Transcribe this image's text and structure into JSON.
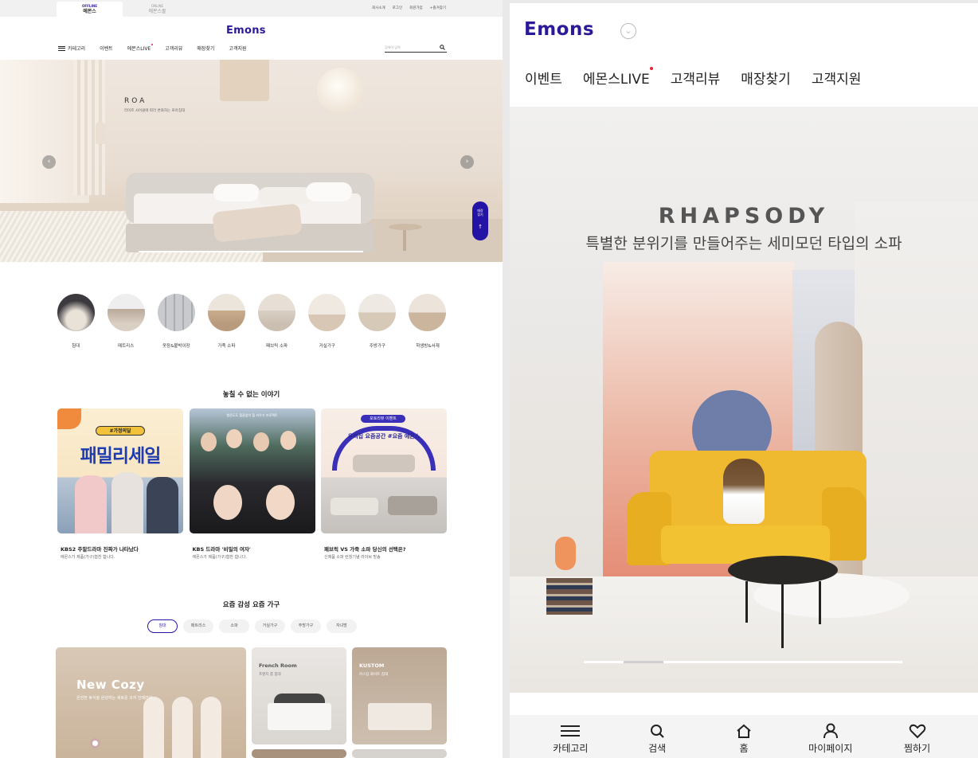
{
  "desktop": {
    "site_tabs": [
      {
        "top": "OFFLINE",
        "label": "에몬스"
      },
      {
        "top": "ONLINE",
        "label": "에몬스몰"
      }
    ],
    "util_links": [
      "회사소개",
      "로그인",
      "회원가입",
      "+즐겨찾기"
    ],
    "logo": "Emons",
    "nav": {
      "category": "카테고리",
      "items": [
        "이벤트",
        "에몬스LIVE",
        "고객리뷰",
        "매장찾기",
        "고객지원"
      ]
    },
    "search": {
      "placeholder": "검색어 입력"
    },
    "hero": {
      "title": "ROA",
      "subtitle": "라이프 사이클에 따라 변화하는 로아침대",
      "store_label_1": "매장",
      "store_label_2": "찾기"
    },
    "categories": [
      "침대",
      "매트리스",
      "옷장&붙박이장",
      "가죽 소파",
      "패브릭 소파",
      "거실가구",
      "주방가구",
      "학생방&서재"
    ],
    "stories_heading": "놓칠 수 없는 이야기",
    "stories": [
      {
        "badge": "#가정의달",
        "banner": "패밀리세일",
        "title": "KBS2 주말드라마 진짜가 나타났다",
        "subtitle": "에몬스가 제품(가구)협찬 합니다."
      },
      {
        "badge": "험준도도 힐끝없이 힐 키우기 프로젝트",
        "banner": "",
        "title": "KBS 드라마 '비밀의 여자'",
        "subtitle": "에몬스가 제품(가구)협찬 합니다."
      },
      {
        "badge": "포토리뷰 이벤트",
        "banner": "우리집 요즘공간 #요즘 에몬스",
        "title": "패브릭 VS 가죽 소파 당신의 선택은?",
        "subtitle": "신제품 소파 런칭기념 라이브 방송"
      }
    ],
    "trend_heading": "요즘 감성 요즘 가구",
    "filters": [
      "침대",
      "매트리스",
      "소파",
      "거실가구",
      "주방가구",
      "자녀방"
    ],
    "products": [
      {
        "title": "New Cozy",
        "subtitle": "온전한 휴식을 완성하는 새로운 코지 인테리어"
      },
      {
        "title": "French Room",
        "subtitle": "프렌치 룸 침대"
      },
      {
        "title": "KUSTOM",
        "subtitle": "커스텀 화이트 침대"
      }
    ]
  },
  "mobile": {
    "logo": "Emons",
    "nav": [
      "이벤트",
      "에몬스LIVE",
      "고객리뷰",
      "매장찾기",
      "고객지원"
    ],
    "hero": {
      "title": "RHAPSODY",
      "subtitle": "특별한 분위기를 만들어주는 세미모던 타입의 소파"
    },
    "tabbar": [
      {
        "icon": "menu-icon",
        "label": "카테고리"
      },
      {
        "icon": "search-icon",
        "label": "검색"
      },
      {
        "icon": "home-icon",
        "label": "홈"
      },
      {
        "icon": "user-icon",
        "label": "마이페이지"
      },
      {
        "icon": "heart-icon",
        "label": "찜하기"
      }
    ]
  },
  "colors": {
    "brand": "#2414a6",
    "accent_dot": "#e22233"
  }
}
